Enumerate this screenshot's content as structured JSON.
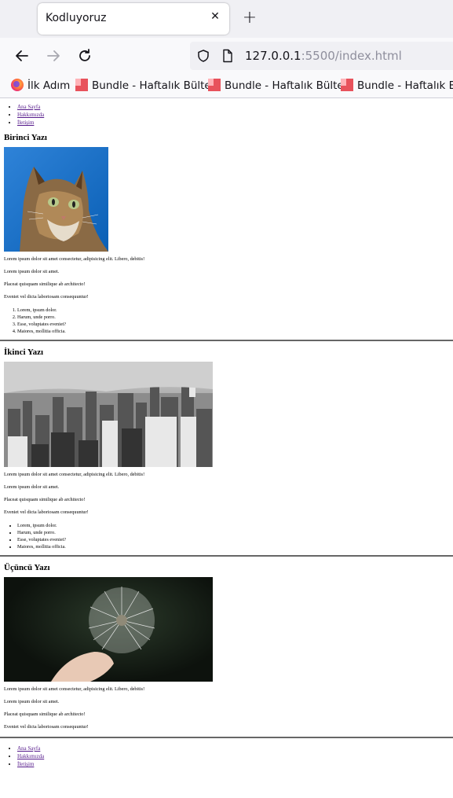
{
  "browser": {
    "tab_title": "Kodluyoruz",
    "tab_close": "✕",
    "new_tab": "+",
    "url_host": "127.0.0.1",
    "url_rest": ":5500/index.html",
    "bookmarks": [
      {
        "label": "İlk Adım",
        "icon": "firefox-icon"
      },
      {
        "label": "Bundle - Haftalık Bülten",
        "icon": "bundle-icon"
      },
      {
        "label": "Bundle - Haftalık Bülten",
        "icon": "bundle-icon"
      },
      {
        "label": "Bundle - Haftalık Bült",
        "icon": "bundle-icon"
      }
    ]
  },
  "page": {
    "nav_top": [
      "Ana Sayfa",
      "Hakkımızda",
      "İletişim"
    ],
    "nav_bottom": [
      "Ana Sayfa",
      "Hakkımızda",
      "İletişim"
    ],
    "posts": [
      {
        "title": "Birinci Yazı",
        "image": "cat-photo",
        "paragraphs": [
          "Lorem ipsum dolor sit amet consectetur, adipisicing elit. Libero, debitis!",
          "Lorem ipsum dolor sit amet.",
          "Placeat quisquam similique ab architecto!",
          "Eveniet vel dicta laboriosam consequuntur!"
        ],
        "list_type": "ordered",
        "list": [
          "Lorem, ipsum dolor.",
          "Harum, unde porro.",
          "Esse, voluptates eveniet?",
          "Maiores, mollitia officia."
        ]
      },
      {
        "title": "İkinci Yazı",
        "image": "city-skyline-photo",
        "paragraphs": [
          "Lorem ipsum dolor sit amet consectetur, adipisicing elit. Libero, debitis!",
          "Lorem ipsum dolor sit amet.",
          "Placeat quisquam similique ab architecto!",
          "Eveniet vel dicta laboriosam consequuntur!"
        ],
        "list_type": "unordered",
        "list": [
          "Lorem, ipsum dolor.",
          "Harum, unde porro.",
          "Esse, voluptates eveniet?",
          "Maiores, mollitia officia."
        ]
      },
      {
        "title": "Üçüncü Yazı",
        "image": "dandelion-photo",
        "paragraphs": [
          "Lorem ipsum dolor sit amet consectetur, adipisicing elit. Libero, debitis!",
          "Lorem ipsum dolor sit amet.",
          "Placeat quisquam similique ab architecto!",
          "Eveniet vel dicta laboriosam consequuntur!"
        ]
      }
    ]
  }
}
